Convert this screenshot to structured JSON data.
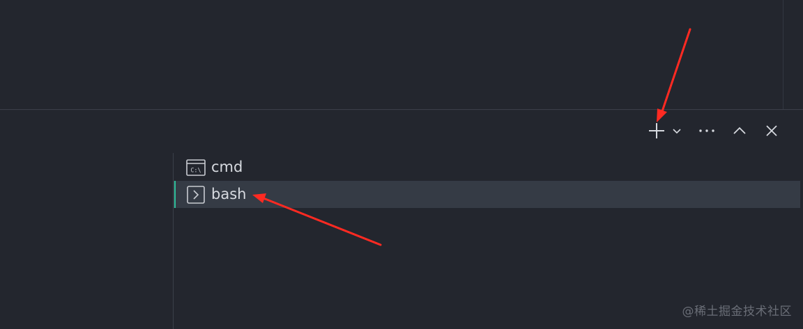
{
  "terminal_panel": {
    "toolbar": {
      "new_terminal_icon": "plus-icon",
      "launch_profile_icon": "chevron-down-icon",
      "more_actions_icon": "ellipsis-icon",
      "maximize_icon": "chevron-up-icon",
      "close_icon": "close-icon"
    },
    "terminals": [
      {
        "label": "cmd",
        "icon": "cmd-terminal-icon",
        "icon_text": "C:\\",
        "active": false
      },
      {
        "label": "bash",
        "icon": "terminal-prompt-icon",
        "active": true
      }
    ]
  },
  "annotations": {
    "arrow_color": "#ff2a22"
  },
  "watermark": "@稀土掘金技术社区",
  "colors": {
    "background": "#23262e",
    "active_row": "#353b45",
    "active_indicator": "#2fbf9b",
    "text": "#d7dae0"
  }
}
